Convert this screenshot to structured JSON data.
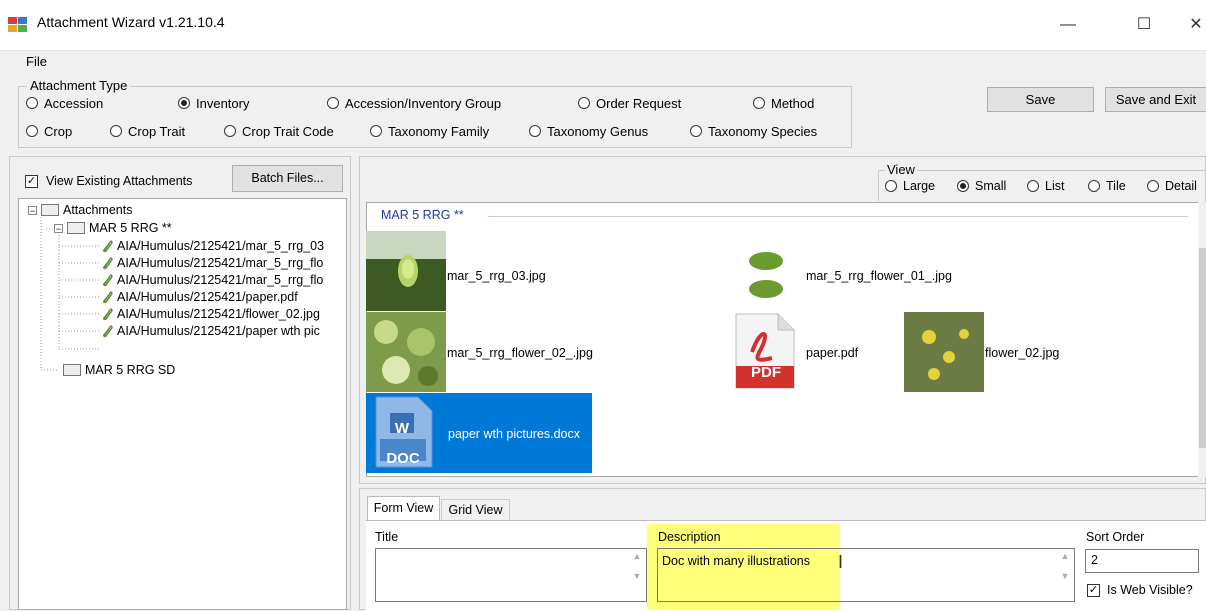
{
  "window": {
    "title": "Attachment Wizard v1.21.10.4",
    "minimize": "—",
    "maximize": "☐",
    "close": "✕"
  },
  "menu": {
    "file": "File"
  },
  "attachment_type": {
    "legend": "Attachment Type",
    "options": [
      {
        "label": "Accession",
        "selected": false
      },
      {
        "label": "Inventory",
        "selected": true
      },
      {
        "label": "Accession/Inventory Group",
        "selected": false
      },
      {
        "label": "Order Request",
        "selected": false
      },
      {
        "label": "Method",
        "selected": false
      },
      {
        "label": "Crop",
        "selected": false
      },
      {
        "label": "Crop Trait",
        "selected": false
      },
      {
        "label": "Crop Trait Code",
        "selected": false
      },
      {
        "label": "Taxonomy Family",
        "selected": false
      },
      {
        "label": "Taxonomy Genus",
        "selected": false
      },
      {
        "label": "Taxonomy Species",
        "selected": false
      }
    ]
  },
  "toolbar": {
    "save": "Save",
    "save_exit": "Save and Exit"
  },
  "left": {
    "view_existing": "View Existing Attachments",
    "view_existing_checked": true,
    "batch_files": "Batch Files...",
    "tree": {
      "root": "Attachments",
      "group1": "MAR 5 RRG **",
      "files": [
        "AIA/Humulus/2125421/mar_5_rrg_03",
        "AIA/Humulus/2125421/mar_5_rrg_flo",
        "AIA/Humulus/2125421/mar_5_rrg_flo",
        "AIA/Humulus/2125421/paper.pdf",
        "AIA/Humulus/2125421/flower_02.jpg",
        "AIA/Humulus/2125421/paper wth pic"
      ],
      "group2": "MAR 5 RRG SD"
    }
  },
  "view": {
    "legend": "View",
    "options": [
      {
        "label": "Large",
        "selected": false
      },
      {
        "label": "Small",
        "selected": true
      },
      {
        "label": "List",
        "selected": false
      },
      {
        "label": "Tile",
        "selected": false
      },
      {
        "label": "Detail",
        "selected": false
      }
    ]
  },
  "files": {
    "group_header": "MAR 5 RRG **",
    "items": [
      "mar_5_rrg_03.jpg",
      "mar_5_rrg_flower_01_.jpg",
      "mar_5_rrg_flower_02_.jpg",
      "paper.pdf",
      "flower_02.jpg",
      "paper wth pictures.docx"
    ],
    "pdf_badge": "PDF",
    "doc_badge": "DOC",
    "doc_letter": "W"
  },
  "form": {
    "tabs": [
      "Form View",
      "Grid View"
    ],
    "title_label": "Title",
    "title_value": "",
    "description_label": "Description",
    "description_value": "Doc with many illustrations",
    "sort_order_label": "Sort Order",
    "sort_order_value": "2",
    "web_visible_label": "Is Web Visible?",
    "web_visible_checked": true
  },
  "colors": {
    "selection": "#0078d7",
    "highlight": "#ffff7a",
    "group_header": "#1f3b9b"
  }
}
